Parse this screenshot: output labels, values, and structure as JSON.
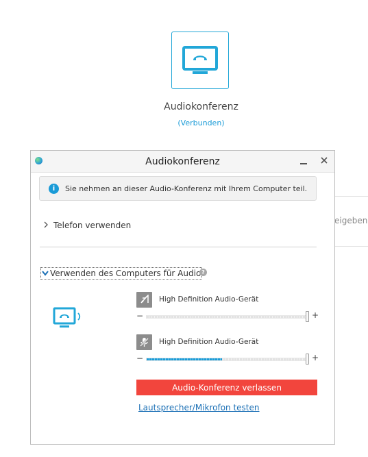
{
  "main": {
    "tile_title": "Audiokonferenz",
    "tile_status": "(Verbunden)",
    "background_partial_text": "eigeben",
    "icon": "monitor-phone-icon",
    "accent": "#22a7d8"
  },
  "dialog": {
    "title": "Audiokonferenz",
    "minimize_icon": "minimize-icon",
    "close_icon": "close-icon",
    "info_text": "Sie nehmen an dieser Audio-Konferenz mit Ihrem Computer teil.",
    "phone_option": "Telefon verwenden",
    "computer_option": "Verwenden des Computers für Audio",
    "speaker": {
      "label": "High Definition Audio-Gerät",
      "icon": "speaker-muted-icon",
      "level": 0
    },
    "microphone": {
      "label": "High Definition Audio-Gerät",
      "icon": "microphone-muted-icon",
      "level": 0.47
    },
    "leave_button": "Audio-Konferenz verlassen",
    "leave_color": "#f2453d",
    "test_link": "Lautsprecher/Mikrofon testen",
    "minus": "−",
    "plus": "+"
  }
}
